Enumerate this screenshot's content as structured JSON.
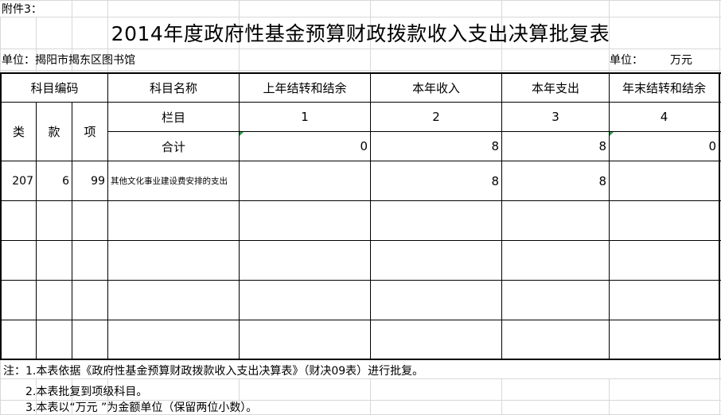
{
  "attachment_label": "附件3：",
  "title": "2014年度政府性基金预算财政拨款收入支出决算批复表",
  "unit_left": "单位：揭阳市揭东区图书馆",
  "unit_right_label": "单位：",
  "unit_right_value": "万元",
  "header": {
    "code": "科目编码",
    "name": "科目名称",
    "prev_balance": "上年结转和结余",
    "income": "本年收入",
    "expense": "本年支出",
    "end_balance": "年末结转和结余",
    "lei": "类",
    "kuan": "款",
    "xiang": "项",
    "lanmu": "栏目",
    "col1": "1",
    "col2": "2",
    "col3": "3",
    "col4": "4",
    "total": "合计"
  },
  "totals": {
    "prev_balance": "0",
    "income": "8",
    "expense": "8",
    "end_balance": "0"
  },
  "rows": [
    {
      "lei": "207",
      "kuan": "6",
      "xiang": "99",
      "name": "其他文化事业建设费安排的支出",
      "prev_balance": "",
      "income": "8",
      "expense": "8",
      "end_balance": ""
    }
  ],
  "notes": [
    "注：1.本表依据《政府性基金预算财政拨款收入支出决算表》（财决09表）进行批复。",
    "2.本表批复到项级科目。",
    "3.本表以“万元 ”为金额单位（保留两位小数）。"
  ],
  "colors": {
    "gridline": "#d4d4d4",
    "border": "#000000",
    "comment_marker": "#1f9d3a"
  }
}
